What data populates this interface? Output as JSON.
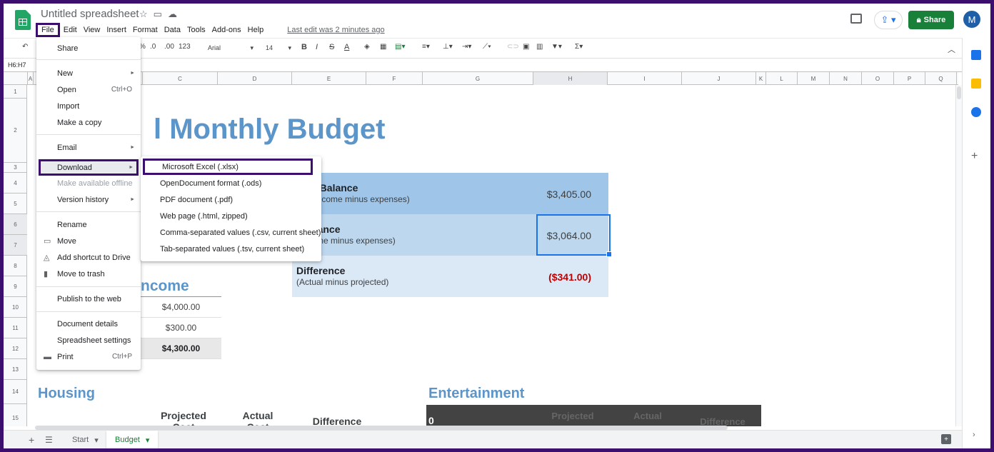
{
  "title": "Untitled spreadsheet",
  "menu": [
    "File",
    "Edit",
    "View",
    "Insert",
    "Format",
    "Data",
    "Tools",
    "Add-ons",
    "Help"
  ],
  "last_edit": "Last edit was 2 minutes ago",
  "share_label": "Share",
  "avatar_letter": "M",
  "toolbar": {
    "percent": "%",
    "dec_less": ".0",
    "dec_more": ".00",
    "format_more": "123",
    "font": "Arial",
    "size": "14",
    "bold": "B",
    "italic": "I",
    "strike": "S",
    "text_color": "A",
    "functions": "Σ"
  },
  "name_box": "H6:H7",
  "columns": [
    "A",
    "B",
    "C",
    "D",
    "E",
    "F",
    "G",
    "H",
    "I",
    "J",
    "K",
    "L",
    "M",
    "N",
    "O",
    "P",
    "Q"
  ],
  "rows": [
    "1",
    "2",
    "3",
    "4",
    "5",
    "6",
    "7",
    "8",
    "9",
    "10",
    "11",
    "12",
    "13",
    "14",
    "15"
  ],
  "sheet": {
    "title_visible": "l Monthly Budget",
    "balances": [
      {
        "label": "cted Balance",
        "sub": "cted income minus expenses)",
        "value": "$3,405.00"
      },
      {
        "label": "l Balance",
        "sub": "l income minus expenses)",
        "value": "$3,064.00"
      },
      {
        "label": "Difference",
        "sub": "(Actual minus projected)",
        "value": "($341.00)"
      }
    ],
    "income_head": "ncome",
    "income_values": [
      "$4,000.00",
      "$300.00",
      "$4,300.00"
    ],
    "housing": "Housing",
    "entertainment": "Entertainment",
    "housing_cols": [
      "Projected Cost",
      "Actual Cost",
      "Difference"
    ],
    "ent_zero": "0",
    "ent_cols": [
      "Projected",
      "Actual",
      "Difference"
    ]
  },
  "tabs": [
    "Start",
    "Budget"
  ],
  "file_menu": {
    "share": "Share",
    "new": "New",
    "open": "Open",
    "open_sc": "Ctrl+O",
    "import": "Import",
    "make_copy": "Make a copy",
    "email": "Email",
    "download": "Download",
    "offline": "Make available offline",
    "version": "Version history",
    "rename": "Rename",
    "move": "Move",
    "add_shortcut": "Add shortcut to Drive",
    "trash": "Move to trash",
    "publish": "Publish to the web",
    "details": "Document details",
    "settings": "Spreadsheet settings",
    "print": "Print",
    "print_sc": "Ctrl+P"
  },
  "download_menu": [
    "Microsoft Excel (.xlsx)",
    "OpenDocument format (.ods)",
    "PDF document (.pdf)",
    "Web page (.html, zipped)",
    "Comma-separated values (.csv, current sheet)",
    "Tab-separated values (.tsv, current sheet)"
  ],
  "colors": {
    "brand_green": "#188038",
    "title_blue": "#5b95c9",
    "highlight": "#3c0f6e"
  }
}
